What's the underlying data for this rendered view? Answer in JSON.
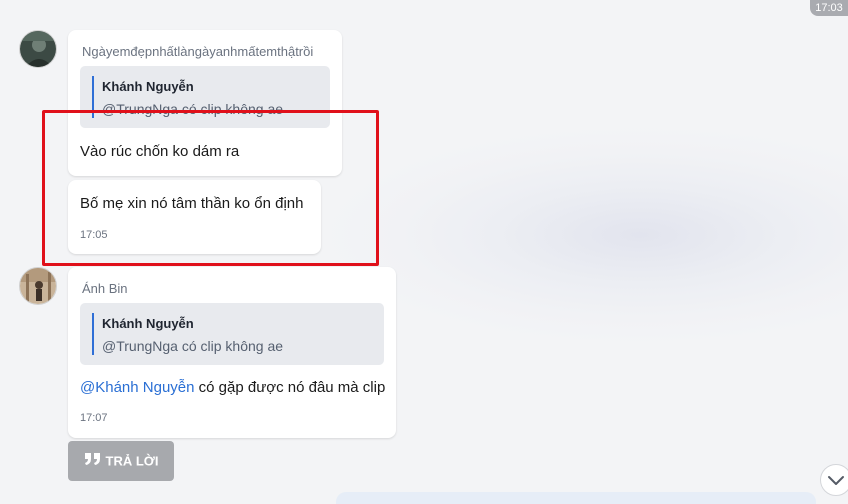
{
  "header": {
    "time": "17:03"
  },
  "messages": [
    {
      "sender": "Ngàyemđẹpnhấtlàngàyanhmấtemthậtrồi",
      "quote": {
        "name": "Khánh Nguyễn",
        "text": "@TrungNga có clip không ae"
      },
      "text": "Vào rúc chốn ko dám ra"
    },
    {
      "text": "Bố mẹ xin nó tâm thần ko ổn định",
      "time": "17:05"
    },
    {
      "sender": "Ánh Bin",
      "quote": {
        "name": "Khánh Nguyễn",
        "text": "@TrungNga có clip không ae"
      },
      "mention": "@Khánh Nguyễn",
      "text": " có gặp được nó đâu mà clip",
      "time": "17:07"
    }
  ],
  "reply_button": {
    "label": "TRẢ LỜI",
    "icon": "quote-icon"
  },
  "scroll_button": {
    "icon": "chevron-down-icon"
  },
  "colors": {
    "highlight": "#e0101a",
    "mention": "#2a6fd4",
    "quote_bar": "#2f6fd6"
  }
}
